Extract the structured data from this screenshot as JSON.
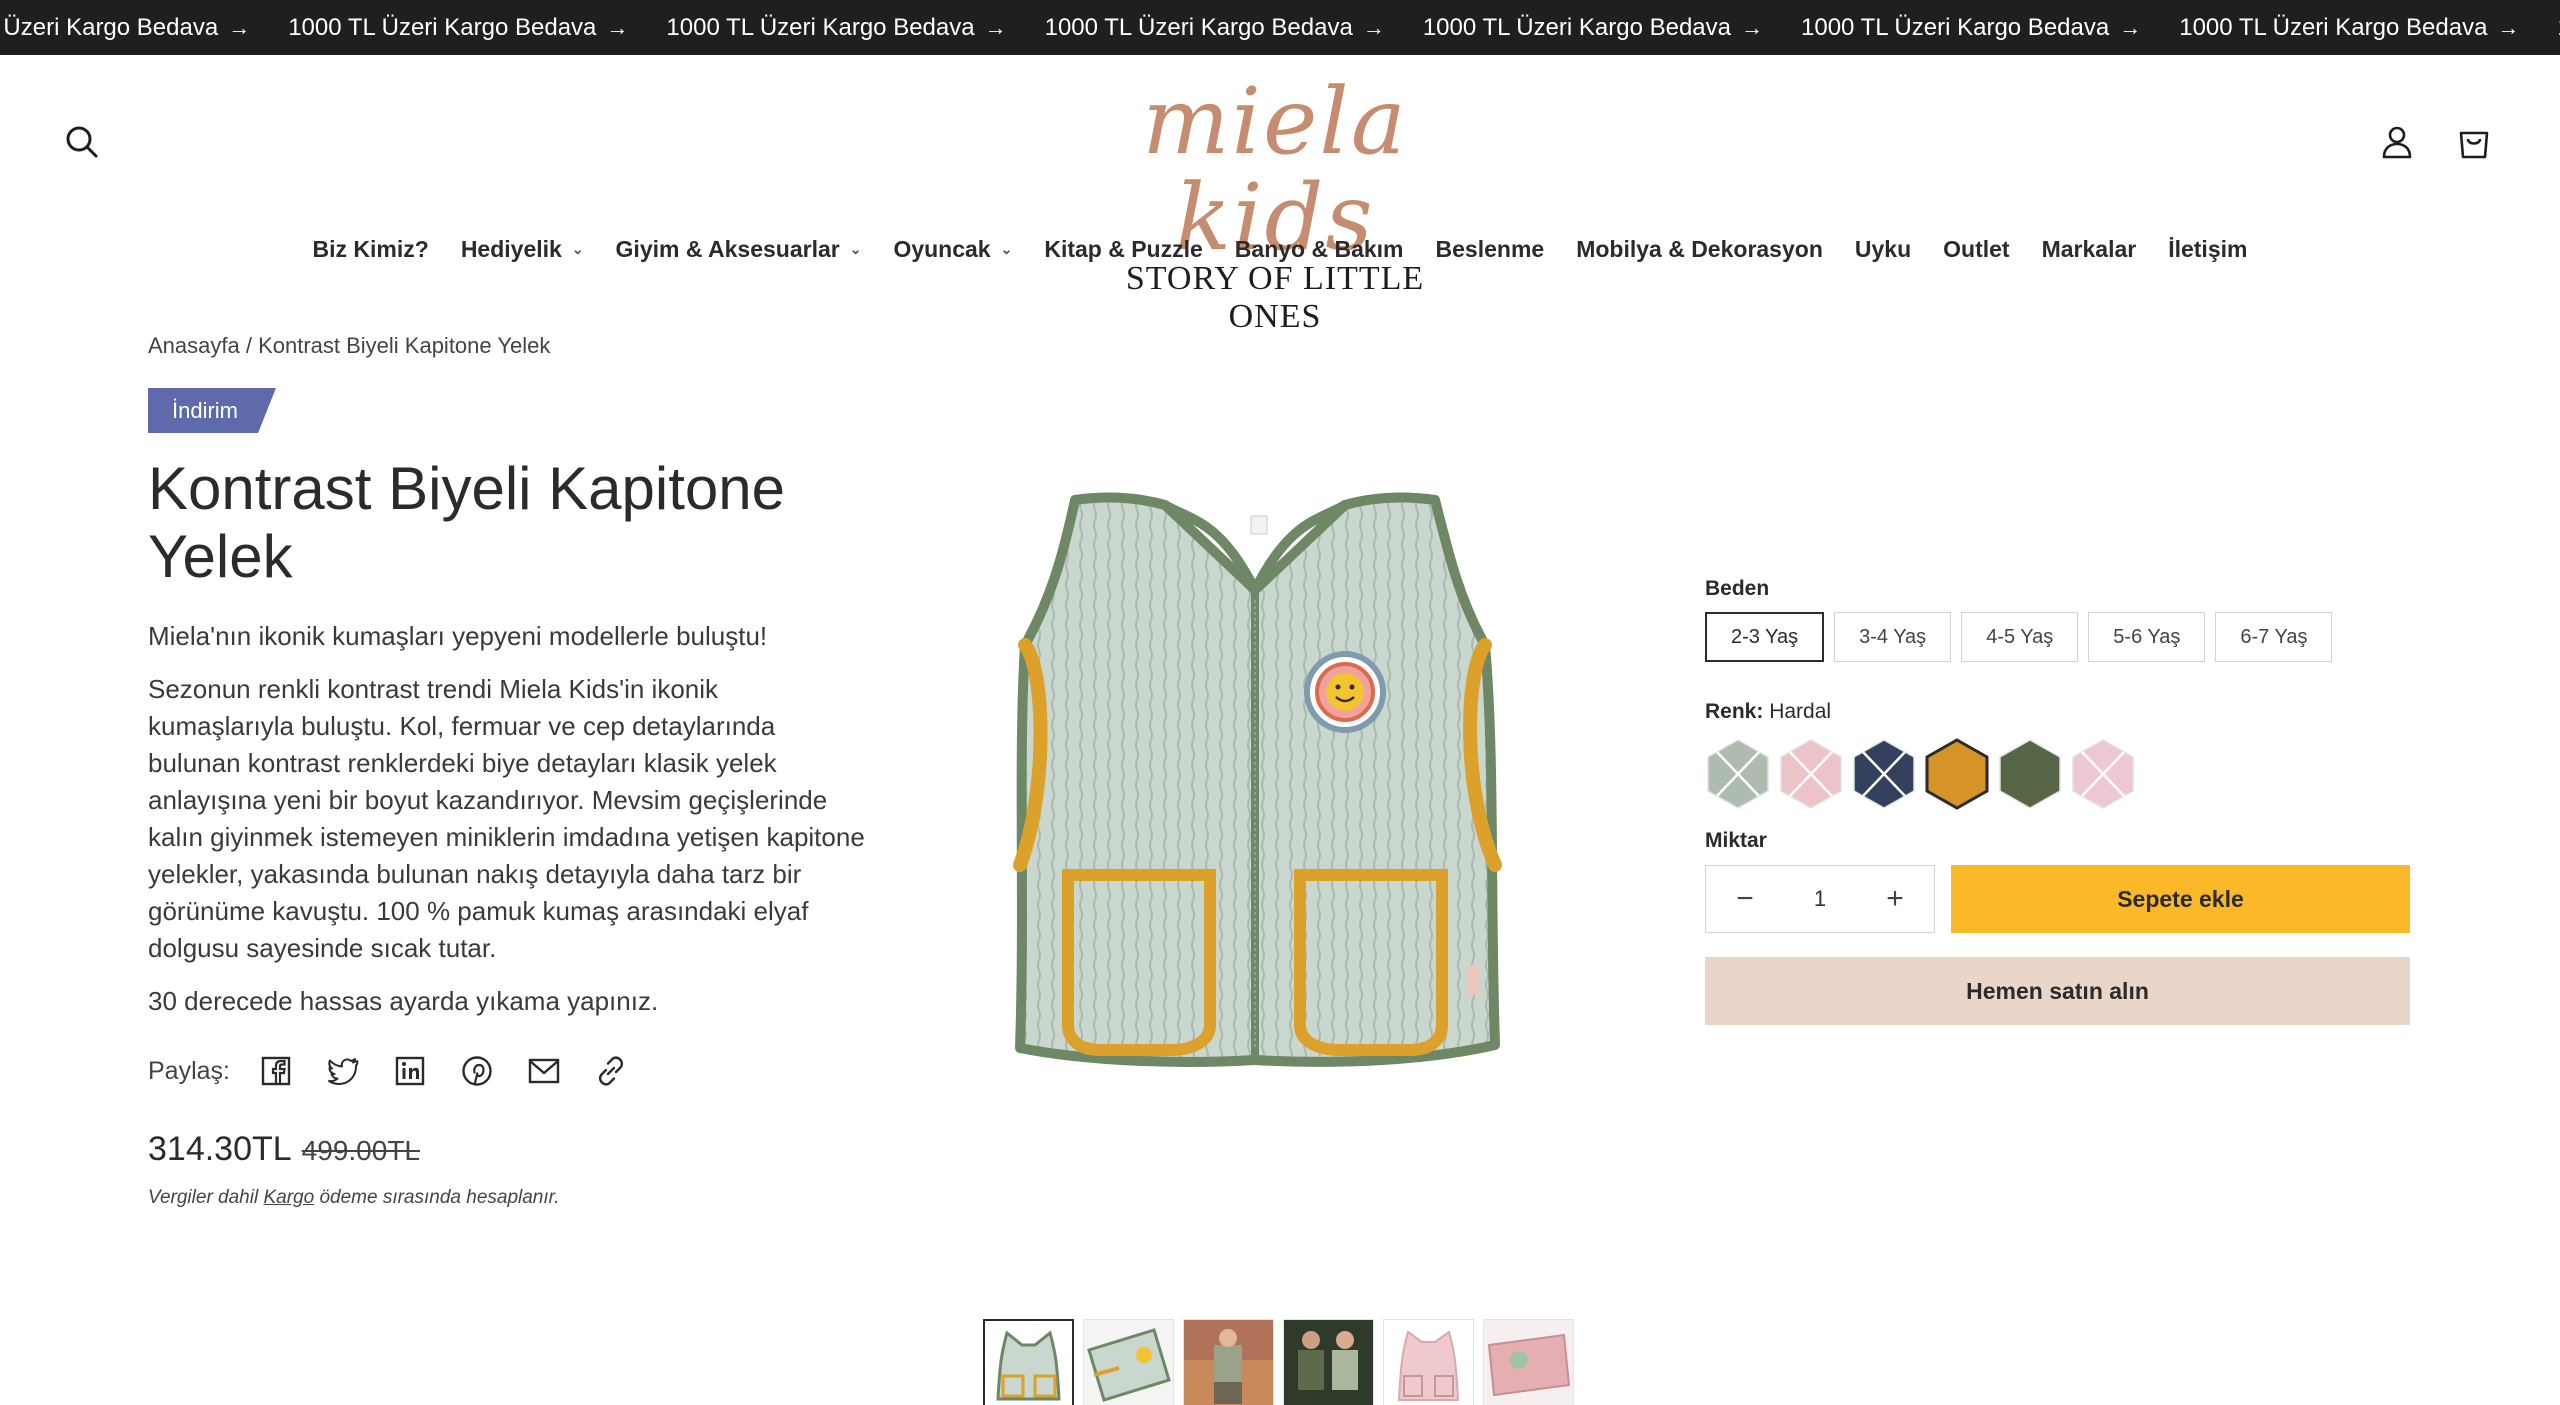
{
  "announcement": {
    "items": [
      "1000 TL Üzeri Kargo Bedava",
      "1000 TL Üzeri Kargo Bedava",
      "1000 TL Üzeri Kargo Bedava",
      "1000 TL Üzeri Kargo Bedava",
      "1000 TL Üzeri Kargo Bedava",
      "1000 TL Üzeri Kargo Bedava",
      "1000 TL Üzeri Kargo Bedava",
      "1000 TL Üzeri Kargo Bedava"
    ],
    "arrow": "→"
  },
  "header": {
    "logo_main": "miela kids",
    "logo_sub": "STORY OF LITTLE ONES",
    "icons": [
      "search-icon",
      "account-icon",
      "cart-icon"
    ]
  },
  "nav": [
    {
      "label": "Biz Kimiz?",
      "dropdown": false
    },
    {
      "label": "Hediyelik",
      "dropdown": true
    },
    {
      "label": "Giyim & Aksesuarlar",
      "dropdown": true
    },
    {
      "label": "Oyuncak",
      "dropdown": true
    },
    {
      "label": "Kitap & Puzzle",
      "dropdown": false
    },
    {
      "label": "Banyo & Bakım",
      "dropdown": false
    },
    {
      "label": "Beslenme",
      "dropdown": false
    },
    {
      "label": "Mobilya & Dekorasyon",
      "dropdown": false
    },
    {
      "label": "Uyku",
      "dropdown": false
    },
    {
      "label": "Outlet",
      "dropdown": false
    },
    {
      "label": "Markalar",
      "dropdown": false
    },
    {
      "label": "İletişim",
      "dropdown": false
    }
  ],
  "breadcrumb": "Anasayfa / Kontrast Biyeli Kapitone Yelek",
  "product": {
    "badge": "İndirim",
    "title": "Kontrast Biyeli Kapitone Yelek",
    "description": [
      "Miela'nın ikonik kumaşları yepyeni modellerle buluştu!",
      "Sezonun renkli kontrast trendi Miela Kids'in ikonik kumaşlarıyla buluştu. Kol, fermuar ve cep detaylarında bulunan kontrast renklerdeki biye detayları klasik yelek anlayışına yeni bir boyut kazandırıyor. Mevsim geçişlerinde kalın giyinmek istemeyen miniklerin imdadına yetişen kapitone yelekler, yakasında bulunan nakış detayıyla daha tarz bir görünüme kavuştu. 100 % pamuk kumaş arasındaki elyaf dolgusu sayesinde sıcak tutar.",
      "30 derecede hassas ayarda yıkama yapınız."
    ],
    "share_label": "Paylaş:",
    "share_icons": [
      "facebook-icon",
      "twitter-icon",
      "linkedin-icon",
      "pinterest-icon",
      "email-icon",
      "link-icon"
    ],
    "price_now": "314.30TL",
    "price_was": "499.00TL",
    "tax_prefix": "Vergiler dahil ",
    "tax_link": "Kargo",
    "tax_suffix": " ödeme sırasında hesaplanır."
  },
  "options": {
    "size_label": "Beden",
    "sizes": [
      "2-3 Yaş",
      "3-4 Yaş",
      "4-5 Yaş",
      "5-6 Yaş",
      "6-7 Yaş"
    ],
    "selected_size": "2-3 Yaş",
    "color_label": "Renk:",
    "color_value": "Hardal",
    "colors": [
      {
        "hex": "#aebcaf",
        "available": false
      },
      {
        "hex": "#ecc4c7",
        "available": false
      },
      {
        "hex": "#34415e",
        "available": false
      },
      {
        "hex": "#d69426",
        "available": true,
        "selected": true
      },
      {
        "hex": "#556546",
        "available": true
      },
      {
        "hex": "#eec7d4",
        "available": false
      }
    ],
    "qty_label": "Miktar",
    "qty_value": "1",
    "qty_minus": "−",
    "qty_plus": "+",
    "add_to_cart": "Sepete ekle",
    "buy_now": "Hemen satın alın"
  }
}
